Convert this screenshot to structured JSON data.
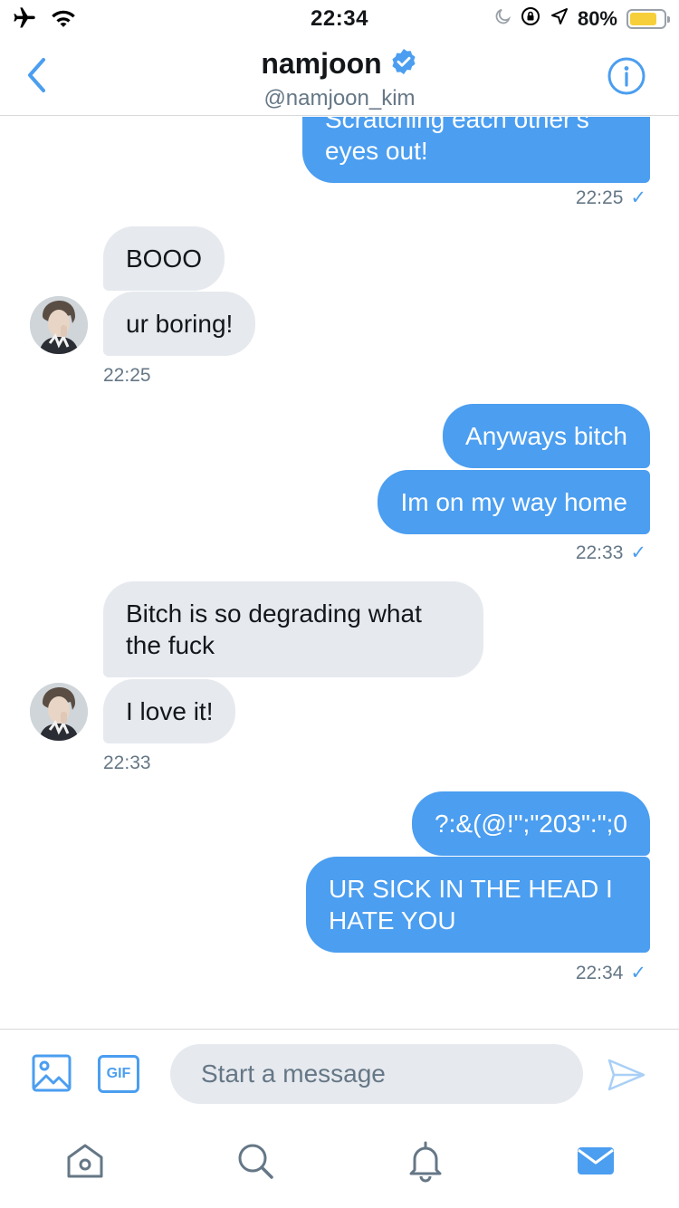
{
  "status_bar": {
    "time": "22:34",
    "battery_percent": "80%",
    "battery_level": 0.8
  },
  "header": {
    "name": "namjoon",
    "handle": "@namjoon_kim",
    "verified": true
  },
  "messages": [
    {
      "side": "out",
      "text": "Scratching each other's eyes out!"
    },
    {
      "side": "out_ts",
      "text": "22:25"
    },
    {
      "side": "in",
      "text": "BOOO"
    },
    {
      "side": "in",
      "text": "ur boring!"
    },
    {
      "side": "in_ts",
      "text": "22:25"
    },
    {
      "side": "out",
      "text": "Anyways bitch"
    },
    {
      "side": "out",
      "text": "Im on my way home"
    },
    {
      "side": "out_ts",
      "text": "22:33"
    },
    {
      "side": "in",
      "text": "Bitch is so degrading what the fuck"
    },
    {
      "side": "in",
      "text": "I love it!"
    },
    {
      "side": "in_ts",
      "text": "22:33"
    },
    {
      "side": "out",
      "text": "?:&(@!\";\"203\":\";0"
    },
    {
      "side": "out",
      "text": "UR SICK IN THE HEAD I HATE YOU"
    },
    {
      "side": "out_ts",
      "text": "22:34"
    }
  ],
  "composer": {
    "placeholder": "Start a message",
    "gif_label": "GIF"
  },
  "colors": {
    "accent": "#4b9ef0",
    "incoming_bubble": "#e6e9ee",
    "battery": "#f7cf3a"
  },
  "icons": {
    "airplane": "airplane-icon",
    "wifi": "wifi-icon",
    "moon": "moon-icon",
    "rotation_lock": "rotation-lock-icon",
    "location": "location-arrow-icon",
    "back": "chevron-left-icon",
    "info": "info-icon",
    "verified": "verified-badge-icon",
    "image": "image-icon",
    "send": "send-icon",
    "home": "home-icon",
    "search": "search-icon",
    "notifications": "bell-icon",
    "messages": "mail-icon"
  }
}
